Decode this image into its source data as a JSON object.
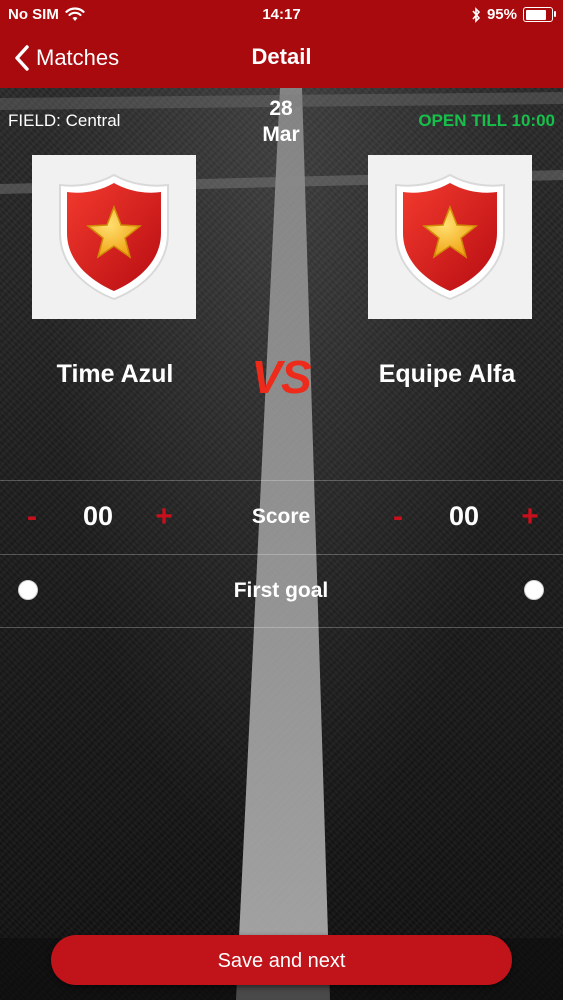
{
  "status_bar": {
    "carrier": "No SIM",
    "time": "14:17",
    "battery": "95%",
    "battery_level": 0.95
  },
  "nav": {
    "back_label": "Matches",
    "title": "Detail"
  },
  "match": {
    "field": "FIELD: Central",
    "date_day": "28",
    "date_month": "Mar",
    "open_till": "OPEN TILL 10:00",
    "vs": "VS",
    "home_team": {
      "name": "Time Azul",
      "logo": "shield-star-icon"
    },
    "away_team": {
      "name": "Equipe Alfa",
      "logo": "shield-star-icon"
    }
  },
  "score": {
    "label": "Score",
    "home": "00",
    "away": "00",
    "minus": "-",
    "plus": "+"
  },
  "first_goal": {
    "label": "First goal"
  },
  "actions": {
    "save_next": "Save and next"
  },
  "colors": {
    "header": "#a80a0d",
    "accent": "#c0131a",
    "open_till": "#16c04b",
    "vs": "#ee2a1b"
  }
}
